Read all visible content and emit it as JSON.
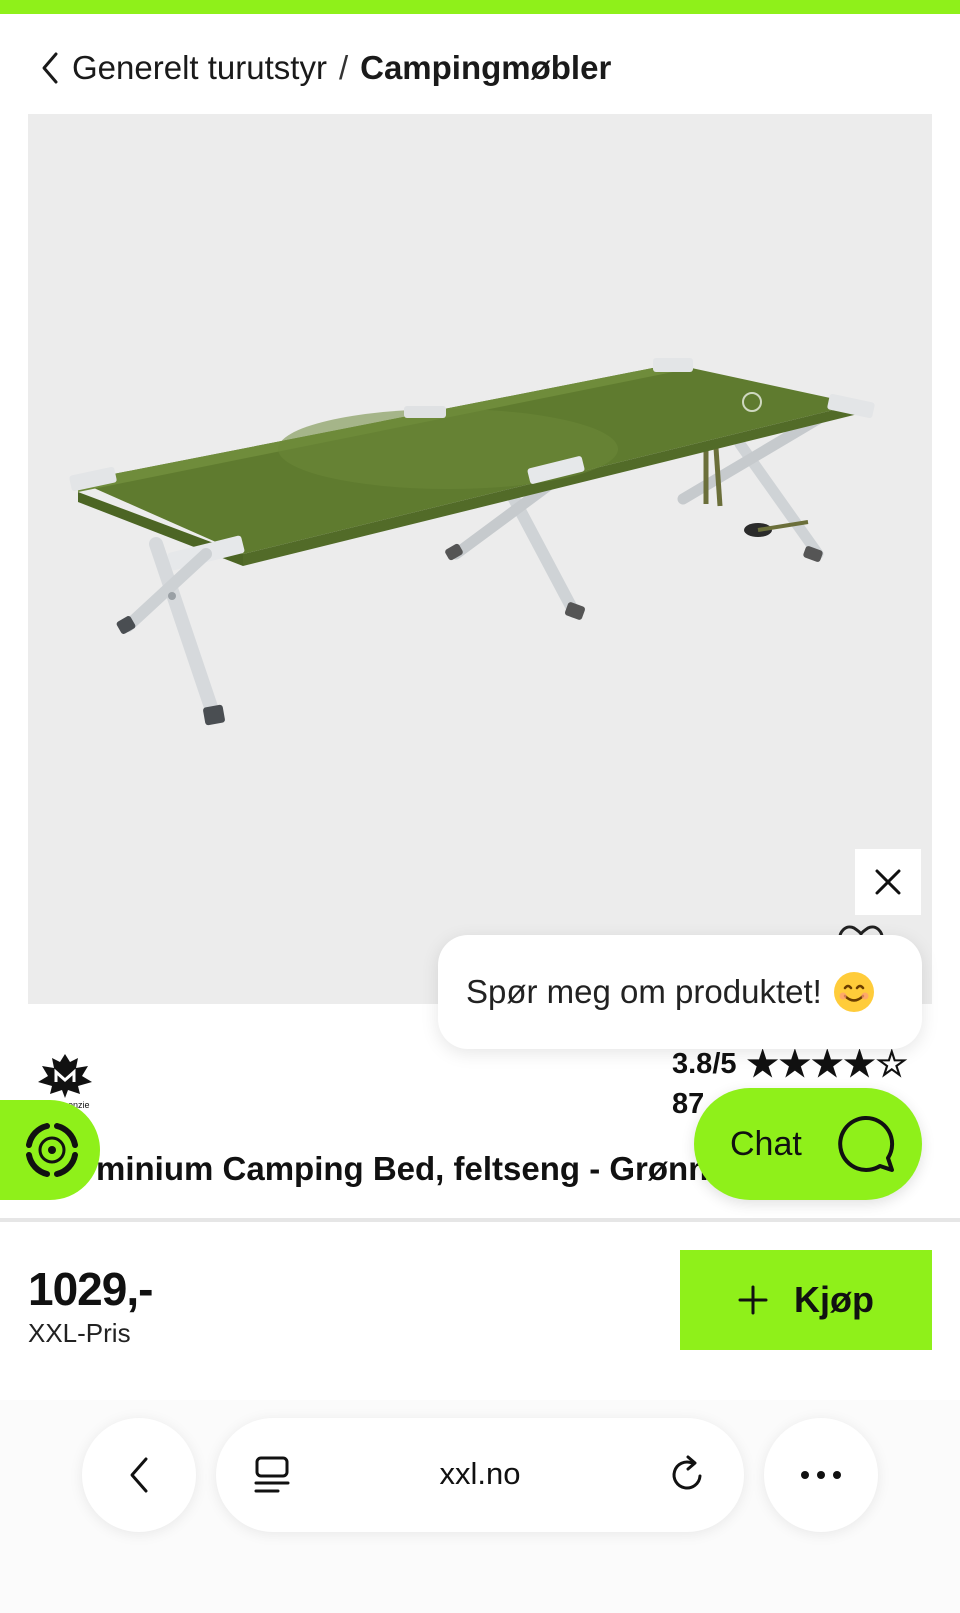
{
  "breadcrumb": {
    "parent": "Generelt turutstyr",
    "separator": "/",
    "current": "Campingmøbler"
  },
  "chat_popup": {
    "message": "Spør meg om produktet!",
    "emoji": "smiling-face-emoji",
    "close_icon": "close-icon"
  },
  "product": {
    "brand_logo": "mckinley-logo",
    "rating": "3.8/5",
    "rating_value": 3.8,
    "rating_max": 5,
    "reviews_visible": "87",
    "title_visible": "minium Camping Bed, feltseng - Grønn"
  },
  "chat_button": {
    "label": "Chat",
    "icon": "chat-bubble-icon"
  },
  "eco_badge": {
    "icon": "recycle-icon"
  },
  "purchase": {
    "price": "1029,-",
    "price_label": "XXL-Pris",
    "buy_label": "Kjøp",
    "buy_icon": "plus-icon"
  },
  "browser": {
    "url": "xxl.no",
    "back_icon": "chevron-left-icon",
    "tabs_icon": "tabs-icon",
    "reload_icon": "reload-icon",
    "more_icon": "more-icon"
  },
  "colors": {
    "accent": "#8ff01a",
    "image_bg": "#ececec",
    "text": "#111111"
  }
}
